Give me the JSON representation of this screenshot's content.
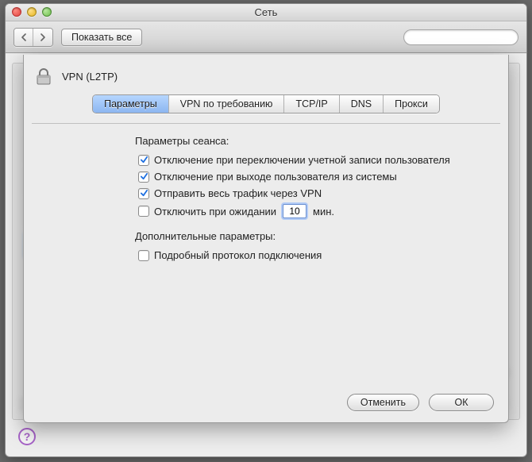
{
  "window": {
    "title": "Сеть"
  },
  "toolbar": {
    "show_all_label": "Показать все",
    "search_placeholder": ""
  },
  "sheet": {
    "title": "VPN (L2TP)",
    "tabs": [
      {
        "label": "Параметры"
      },
      {
        "label": "VPN по требованию"
      },
      {
        "label": "TCP/IP"
      },
      {
        "label": "DNS"
      },
      {
        "label": "Прокси"
      }
    ],
    "active_tab": 0,
    "session_heading": "Параметры сеанса:",
    "options": {
      "disconnect_on_switch": {
        "label": "Отключение при переключении учетной записи пользователя",
        "checked": true
      },
      "disconnect_on_logout": {
        "label": "Отключение при выходе пользователя из системы",
        "checked": true
      },
      "send_all_traffic": {
        "label": "Отправить весь трафик через VPN",
        "checked": true
      },
      "disconnect_idle": {
        "label_prefix": "Отключить при ожидании",
        "value": "10",
        "label_suffix": "мин.",
        "checked": false
      }
    },
    "advanced_heading": "Дополнительные параметры:",
    "advanced": {
      "verbose_log": {
        "label": "Подробный протокол подключения",
        "checked": false
      }
    },
    "buttons": {
      "cancel": "Отменить",
      "ok": "ОК"
    }
  }
}
